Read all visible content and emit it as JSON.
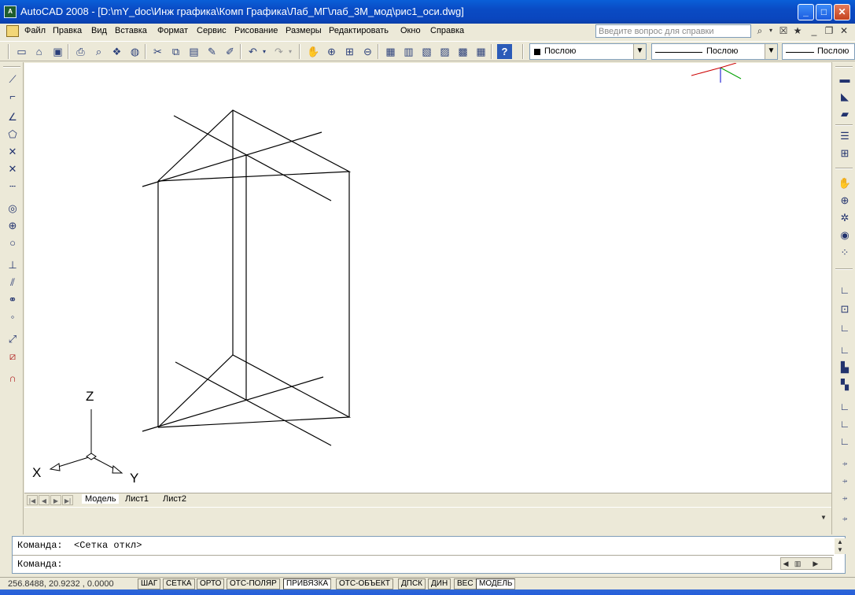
{
  "window": {
    "title": "AutoCAD 2008 - [D:\\mY_doc\\Инж графика\\Комп Графика\\Лаб_МГ\\лаб_3М_мод\\рис1_оси.dwg]",
    "app_icon_label": "A"
  },
  "menu": {
    "items": [
      "Файл",
      "Правка",
      "Вид",
      "Вставка",
      "Формат",
      "Сервис",
      "Рисование",
      "Размеры",
      "Редактировать",
      "Окно",
      "Справка"
    ],
    "help_placeholder": "Введите вопрос для справки"
  },
  "toolbar": {
    "color_combo": "Послою",
    "linetype_combo": "Послою",
    "lineweight_combo": "Послою"
  },
  "ucs_icon": {
    "z_label": "Z",
    "x_label": "X",
    "y_label": "Y"
  },
  "tabs": {
    "items": [
      "Модель",
      "Лист1",
      "Лист2"
    ],
    "active": "Модель"
  },
  "command": {
    "history_line": "Команда:  <Сетка откл>",
    "prompt": "Команда:"
  },
  "status": {
    "coordinates": "256.8488, 20.9232 , 0.0000",
    "buttons": [
      "ШАГ",
      "СЕТКА",
      "ОРТО",
      "ОТС-ПОЛЯР",
      "ПРИВЯЗКА",
      "ОТС-ОБЪЕКТ",
      "ДПСК",
      "ДИН",
      "ВЕС",
      "МОДЕЛЬ"
    ]
  },
  "colors": {
    "titlebar": "#0a4bc4",
    "chrome": "#ece9d8",
    "canvas": "#ffffff",
    "ucs_x_axis": "#cc0000",
    "ucs_y_axis": "#00a000",
    "ucs_z_axis": "#0000cc"
  }
}
